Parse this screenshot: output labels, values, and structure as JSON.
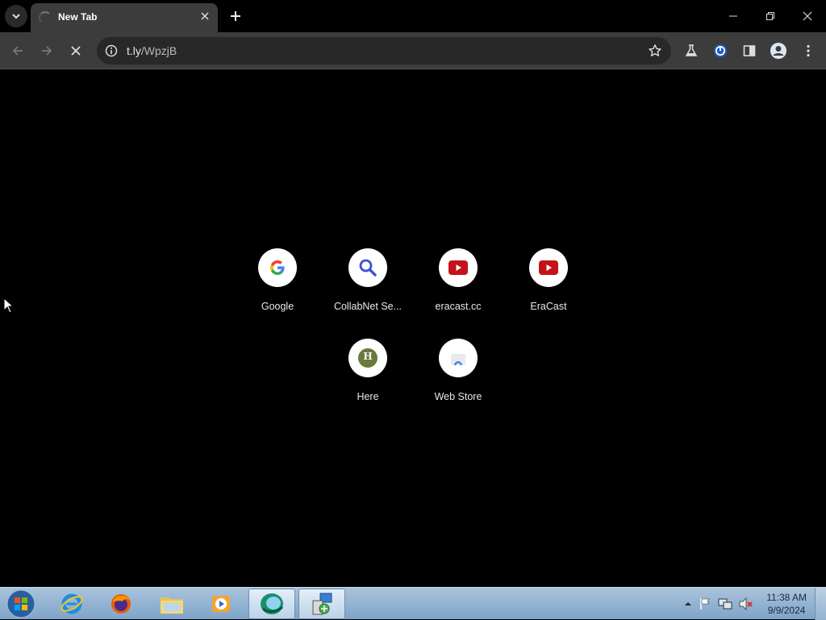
{
  "browser": {
    "tab": {
      "title": "New Tab"
    },
    "omnibox": {
      "url_host": "t.ly",
      "url_path": "/WpzjB"
    }
  },
  "shortcuts": [
    {
      "label": "Google",
      "icon": "google-icon"
    },
    {
      "label": "CollabNet Se...",
      "icon": "magnifier-icon"
    },
    {
      "label": "eracast.cc",
      "icon": "youtube-icon"
    },
    {
      "label": "EraCast",
      "icon": "youtube-icon"
    },
    {
      "label": "Here",
      "icon": "letter-h-icon",
      "letter": "H"
    },
    {
      "label": "Web Store",
      "icon": "web-store-icon"
    }
  ],
  "taskbar": {
    "apps": [
      "internet-explorer-icon",
      "firefox-icon",
      "file-explorer-icon",
      "media-player-icon",
      "chrome-app-icon",
      "installer-icon"
    ],
    "clock": {
      "time": "11:38 AM",
      "date": "9/9/2024"
    }
  },
  "colors": {
    "tab_bg": "#3c3c3c",
    "toolbar_bg": "#3c3c3c",
    "omnibox_bg": "#282828",
    "page_bg": "#000000",
    "youtube_red": "#c4121a",
    "here_green": "#6b7a3a"
  }
}
